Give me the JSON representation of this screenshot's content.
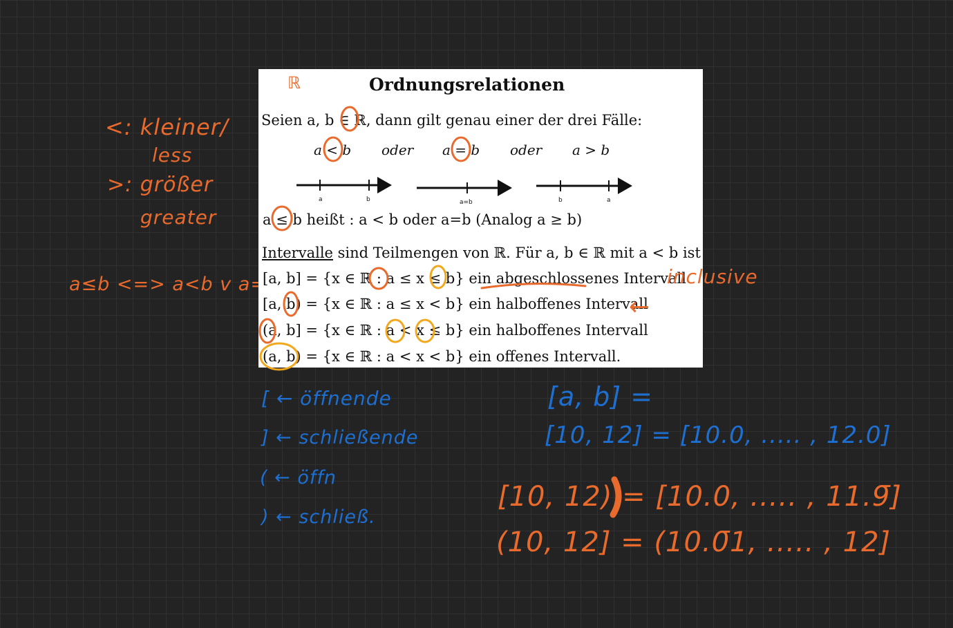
{
  "document": {
    "title": "Ordnungsrelationen",
    "real_symbol": "ℝ",
    "intro": "Seien a, b ∈ ℝ, dann gilt genau einer der drei Fälle:",
    "cases": [
      "a < b",
      "oder",
      "a = b",
      "oder",
      "a > b"
    ],
    "number_lines": [
      {
        "labels": [
          "a",
          "b"
        ]
      },
      {
        "labels": [
          "a=b"
        ]
      },
      {
        "labels": [
          "b",
          "a"
        ]
      }
    ],
    "leq_line": "a ≤ b heißt : a < b oder a=b (Analog a ≥ b)",
    "intervals_intro": {
      "underlined": "Intervalle",
      "rest": " sind Teilmengen von ℝ. Für a, b ∈ ℝ mit a < b ist"
    },
    "intervals": [
      {
        "notation": "[a, b]",
        "set": " = {x ∈ ℝ : a ≤ x ≤ b}",
        "desc_pre": " ein ",
        "desc_underlined": "abgeschlossenes",
        "desc_post": " Intervall"
      },
      {
        "notation": "[a, b)",
        "set": " = {x ∈ ℝ : a ≤ x < b}",
        "desc_pre": " ein halboffenes Intervall",
        "desc_underlined": "",
        "desc_post": ""
      },
      {
        "notation": "(a, b]",
        "set": " = {x ∈ ℝ : a < x ≤ b}",
        "desc_pre": " ein halboffenes Intervall",
        "desc_underlined": "",
        "desc_post": ""
      },
      {
        "notation": "(a, b)",
        "set": " = {x ∈ ℝ : a < x < b}",
        "desc_pre": " ein offenes Intervall.",
        "desc_underlined": "",
        "desc_post": ""
      }
    ]
  },
  "annotations": {
    "orange": {
      "real_note": "ℝ",
      "less": "<: kleiner/",
      "less_en": "less",
      "greater": ">: größer",
      "greater_en": "greater",
      "equiv": "a≤b <=> a<b v a=b",
      "inclusive": "inclusive",
      "arrow": "←",
      "example3": "[10, 12) = [10.0, ..... , 11.9̄]",
      "example4": "(10, 12] = (10.0̄1, ..... , 12]"
    },
    "blue": {
      "bracket_open": "[ ← öffnende",
      "bracket_close": "] ← schließende",
      "paren_open": "( ← öffn",
      "paren_close": ") ← schließ.",
      "example1": "[a, b] =",
      "example2": "[10, 12] = [10.0, ..... , 12.0]"
    },
    "colors": {
      "orange": "#e86a2c",
      "blue": "#1d6fd1",
      "yellow": "#f2a81d",
      "background": "#232323"
    }
  }
}
